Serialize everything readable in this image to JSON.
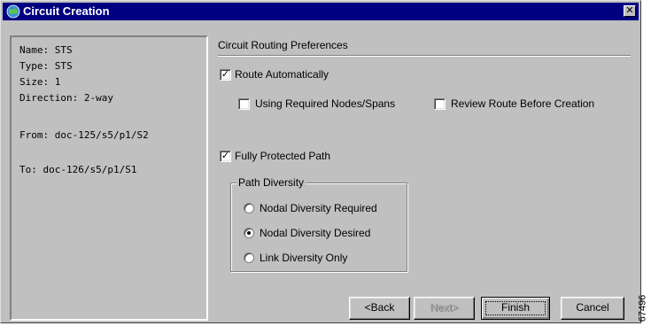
{
  "window": {
    "title": "Circuit Creation",
    "close_glyph": "✕"
  },
  "info": {
    "lines": [
      "Name: STS",
      "Type: STS",
      "Size: 1",
      "Direction: 2-way",
      "From: doc-125/s5/p1/S2",
      "To: doc-126/s5/p1/S1"
    ]
  },
  "routing": {
    "section_title": "Circuit Routing Preferences",
    "route_automatically": {
      "label": "Route Automatically",
      "checked": true
    },
    "using_required_nodes": {
      "label": "Using Required Nodes/Spans",
      "checked": false
    },
    "review_route": {
      "label": "Review Route Before Creation",
      "checked": false
    },
    "fully_protected": {
      "label": "Fully Protected Path",
      "checked": true
    },
    "path_diversity": {
      "title": "Path Diversity",
      "options": [
        {
          "label": "Nodal Diversity Required",
          "selected": false
        },
        {
          "label": "Nodal Diversity Desired",
          "selected": true
        },
        {
          "label": "Link Diversity Only",
          "selected": false
        }
      ]
    }
  },
  "buttons": {
    "back": "<Back",
    "next": "Next>",
    "finish": "Finish",
    "cancel": "Cancel"
  },
  "figure_id": "67496",
  "colors": {
    "titlebar": "#000080",
    "face": "#c0c0c0"
  }
}
